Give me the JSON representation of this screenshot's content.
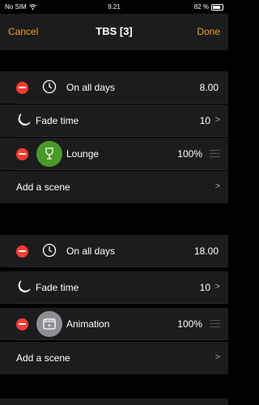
{
  "status": {
    "carrier": "No SIM",
    "time": "9.21",
    "battery": "82 %"
  },
  "nav": {
    "cancel": "Cancel",
    "title": "TBS [3]",
    "done": "Done"
  },
  "groups": [
    {
      "days": "On all days",
      "time": "8.00",
      "fade_label": "Fade time",
      "fade_value": "10",
      "scene": {
        "name": "Lounge",
        "percent": "100%",
        "icon": "wine-glass-icon",
        "color": "#4a9a2a"
      },
      "add_scene": "Add a scene"
    },
    {
      "days": "On all days",
      "time": "18.00",
      "fade_label": "Fade time",
      "fade_value": "10",
      "scene": {
        "name": "Animation",
        "percent": "100%",
        "icon": "film-icon",
        "color": "#8e8e93"
      },
      "add_scene": "Add a scene"
    }
  ],
  "chevron": ">"
}
